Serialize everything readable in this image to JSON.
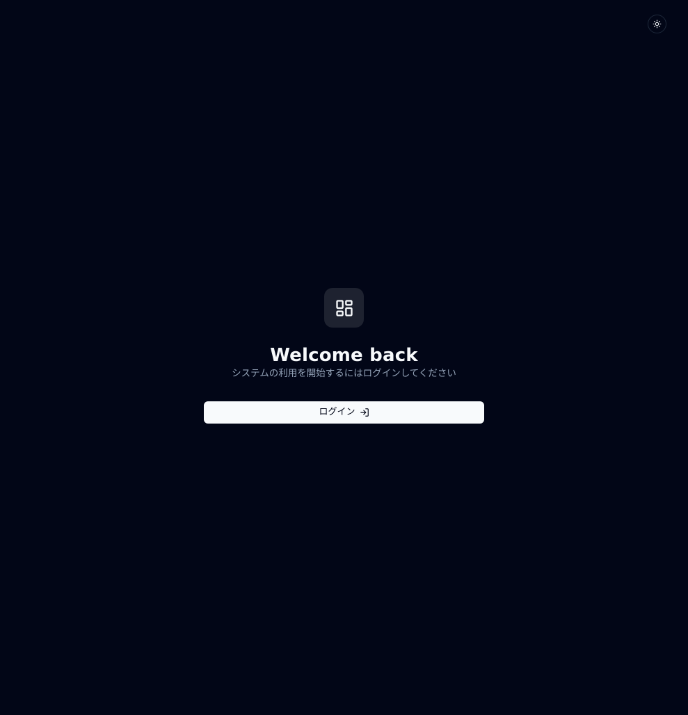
{
  "header": {
    "theme_toggle_icon": "sun-icon"
  },
  "main": {
    "logo_icon": "layout-dashboard-icon",
    "title": "Welcome back",
    "subtitle": "システムの利用を開始するにはログインしてください",
    "login_button": {
      "label": "ログイン",
      "icon": "log-in-icon"
    }
  },
  "colors": {
    "background": "#020617",
    "logo_box": "#1e2230",
    "button_bg": "#f8fafc",
    "subtitle_text": "#94a3b8"
  }
}
